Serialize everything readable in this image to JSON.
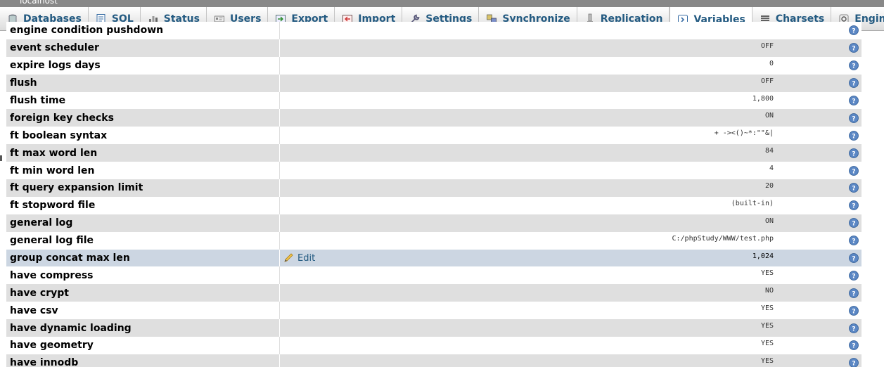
{
  "breadcrumb": "localhost",
  "tabs": [
    {
      "label": "Databases",
      "icon": "database-icon",
      "active": false
    },
    {
      "label": "SQL",
      "icon": "sql-icon",
      "active": false
    },
    {
      "label": "Status",
      "icon": "status-icon",
      "active": false
    },
    {
      "label": "Users",
      "icon": "users-icon",
      "active": false
    },
    {
      "label": "Export",
      "icon": "export-icon",
      "active": false
    },
    {
      "label": "Import",
      "icon": "import-icon",
      "active": false
    },
    {
      "label": "Settings",
      "icon": "wrench-icon",
      "active": false
    },
    {
      "label": "Synchronize",
      "icon": "synchronize-icon",
      "active": false
    },
    {
      "label": "Replication",
      "icon": "replication-icon",
      "active": false
    },
    {
      "label": "Variables",
      "icon": "variables-icon",
      "active": true
    },
    {
      "label": "Charsets",
      "icon": "charsets-icon",
      "active": false
    },
    {
      "label": "Engines",
      "icon": "engines-icon",
      "active": false
    }
  ],
  "edit_label": "Edit",
  "rows": [
    {
      "name": "engine condition pushdown",
      "value": ""
    },
    {
      "name": "event scheduler",
      "value": "OFF"
    },
    {
      "name": "expire logs days",
      "value": "0"
    },
    {
      "name": "flush",
      "value": "OFF"
    },
    {
      "name": "flush time",
      "value": "1,800"
    },
    {
      "name": "foreign key checks",
      "value": "ON"
    },
    {
      "name": "ft boolean syntax",
      "value": "+ -><()~*:\"\"&|"
    },
    {
      "name": "ft max word len",
      "value": "84"
    },
    {
      "name": "ft min word len",
      "value": "4"
    },
    {
      "name": "ft query expansion limit",
      "value": "20"
    },
    {
      "name": "ft stopword file",
      "value": "(built-in)"
    },
    {
      "name": "general log",
      "value": "ON"
    },
    {
      "name": "general log file",
      "value": "C:/phpStudy/WWW/test.php"
    },
    {
      "name": "group concat max len",
      "value": "1,024",
      "highlighted": true
    },
    {
      "name": "have compress",
      "value": "YES"
    },
    {
      "name": "have crypt",
      "value": "NO"
    },
    {
      "name": "have csv",
      "value": "YES"
    },
    {
      "name": "have dynamic loading",
      "value": "YES"
    },
    {
      "name": "have geometry",
      "value": "YES"
    },
    {
      "name": "have innodb",
      "value": "YES"
    }
  ],
  "colors": {
    "tab_text": "#235a81",
    "row_even": "#dfdfdf",
    "row_highlight": "#ccd6e2",
    "help_icon": "#3a6ea5"
  }
}
